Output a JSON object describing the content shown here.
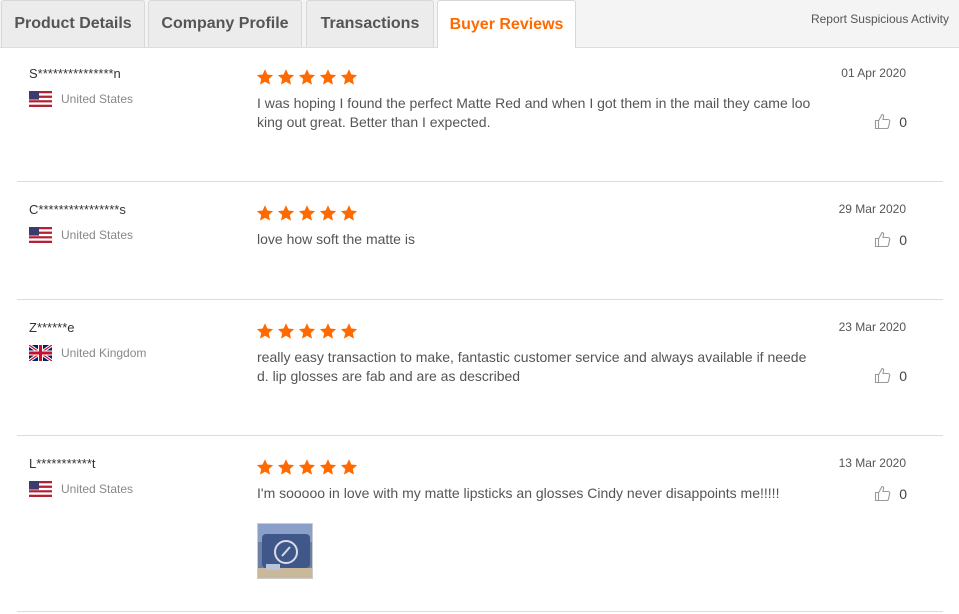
{
  "tabs": [
    {
      "label": "Product Details"
    },
    {
      "label": "Company Profile"
    },
    {
      "label": "Transactions"
    },
    {
      "label": "Buyer Reviews"
    }
  ],
  "active_tab": "Buyer Reviews",
  "report_link": "Report Suspicious Activity",
  "colors": {
    "accent": "#ff6a00",
    "star": "#ff6a00",
    "divider": "#dcdcdc"
  },
  "reviews": [
    {
      "name": "S***************n",
      "country": "United States",
      "flag": "us-flag-icon",
      "rating": 5,
      "text": "I was hoping I found the perfect Matte Red and when I got them in the mail they came looking out great. Better than I expected.",
      "date": "01 Apr 2020",
      "likes": "0"
    },
    {
      "name": "C****************s",
      "country": "United States",
      "flag": "us-flag-icon",
      "rating": 5,
      "text": "love how soft the matte is",
      "date": "29 Mar 2020",
      "likes": "0"
    },
    {
      "name": "Z******e",
      "country": "United Kingdom",
      "flag": "uk-flag-icon",
      "rating": 5,
      "text": "really easy transaction to make, fantastic customer service and always available if needed. lip glosses are fab and are as described",
      "date": "23 Mar 2020",
      "likes": "0"
    },
    {
      "name": "L***********t",
      "country": "United States",
      "flag": "us-flag-icon",
      "rating": 5,
      "text": "I'm sooooo in love with my matte lipsticks an glosses Cindy never disappoints me!!!!!",
      "date": "13 Mar 2020",
      "likes": "0",
      "has_photo": true
    }
  ]
}
